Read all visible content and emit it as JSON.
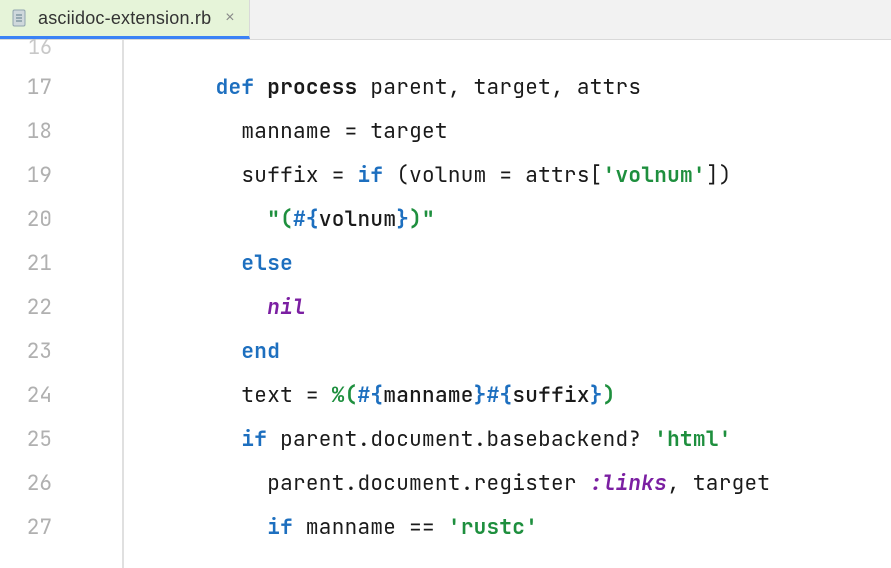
{
  "tab": {
    "filename": "asciidoc-extension.rb",
    "close_glyph": "×"
  },
  "lines": [
    {
      "num": "16",
      "tokens": []
    },
    {
      "num": "17",
      "tokens": [
        {
          "t": "    ",
          "c": ""
        },
        {
          "t": "def ",
          "c": "kw"
        },
        {
          "t": "process ",
          "c": "bold-ident"
        },
        {
          "t": "parent, target, attrs",
          "c": ""
        }
      ]
    },
    {
      "num": "18",
      "tokens": [
        {
          "t": "      ",
          "c": ""
        },
        {
          "t": "manname = target",
          "c": ""
        }
      ]
    },
    {
      "num": "19",
      "tokens": [
        {
          "t": "      ",
          "c": ""
        },
        {
          "t": "suffix = ",
          "c": ""
        },
        {
          "t": "if ",
          "c": "kw"
        },
        {
          "t": "(volnum = attrs[",
          "c": ""
        },
        {
          "t": "'volnum'",
          "c": "str"
        },
        {
          "t": "])",
          "c": ""
        }
      ]
    },
    {
      "num": "20",
      "tokens": [
        {
          "t": "        ",
          "c": ""
        },
        {
          "t": "\"(",
          "c": "str"
        },
        {
          "t": "#{",
          "c": "kw"
        },
        {
          "t": "volnum",
          "c": "interp"
        },
        {
          "t": "}",
          "c": "kw"
        },
        {
          "t": ")\"",
          "c": "str"
        }
      ]
    },
    {
      "num": "21",
      "tokens": [
        {
          "t": "      ",
          "c": ""
        },
        {
          "t": "else",
          "c": "kw"
        }
      ]
    },
    {
      "num": "22",
      "tokens": [
        {
          "t": "        ",
          "c": ""
        },
        {
          "t": "nil",
          "c": "lit"
        }
      ]
    },
    {
      "num": "23",
      "tokens": [
        {
          "t": "      ",
          "c": ""
        },
        {
          "t": "end",
          "c": "kw"
        }
      ]
    },
    {
      "num": "24",
      "tokens": [
        {
          "t": "      ",
          "c": ""
        },
        {
          "t": "text = ",
          "c": ""
        },
        {
          "t": "%(",
          "c": "str"
        },
        {
          "t": "#{",
          "c": "kw"
        },
        {
          "t": "manname",
          "c": "interp"
        },
        {
          "t": "}",
          "c": "kw"
        },
        {
          "t": "#{",
          "c": "kw"
        },
        {
          "t": "suffix",
          "c": "interp"
        },
        {
          "t": "}",
          "c": "kw"
        },
        {
          "t": ")",
          "c": "str"
        }
      ]
    },
    {
      "num": "25",
      "tokens": [
        {
          "t": "      ",
          "c": ""
        },
        {
          "t": "if ",
          "c": "kw"
        },
        {
          "t": "parent.document.basebackend? ",
          "c": ""
        },
        {
          "t": "'html'",
          "c": "str"
        }
      ]
    },
    {
      "num": "26",
      "tokens": [
        {
          "t": "        ",
          "c": ""
        },
        {
          "t": "parent.document.register ",
          "c": ""
        },
        {
          "t": ":links",
          "c": "sym"
        },
        {
          "t": ", target",
          "c": ""
        }
      ]
    },
    {
      "num": "27",
      "tokens": [
        {
          "t": "        ",
          "c": ""
        },
        {
          "t": "if ",
          "c": "kw"
        },
        {
          "t": "manname == ",
          "c": ""
        },
        {
          "t": "'rustc'",
          "c": "str"
        }
      ]
    }
  ]
}
